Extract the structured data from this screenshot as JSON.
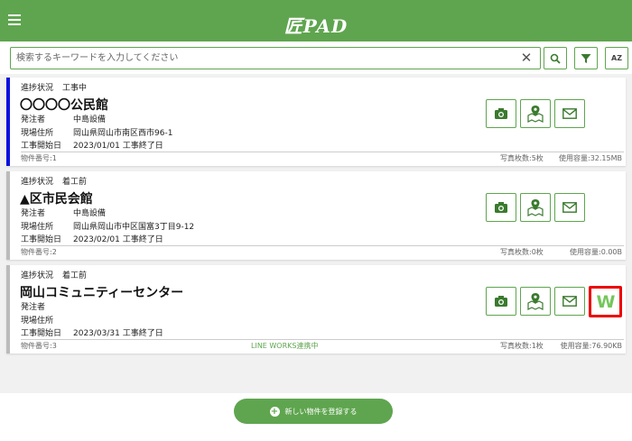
{
  "header": {
    "title": "匠PAD",
    "menu_icon": "hamburger-menu-icon"
  },
  "search": {
    "placeholder": "検索するキーワードを入力してください",
    "clear": "✕",
    "buttons": [
      "search-icon",
      "filter-icon",
      "sort-az-icon"
    ],
    "sort_label": "AZ"
  },
  "cards": [
    {
      "status_label": "進捗状況",
      "status": "工事中",
      "title": "〇〇〇〇公民館",
      "orderer_label": "発注者",
      "orderer": "中島設備",
      "address_label": "現場住所",
      "address": "岡山県岡山市南区西市96-1",
      "start_label": "工事開始日",
      "start": "2023/01/01",
      "end_label": "工事終了日",
      "number": "物件番号:1",
      "lineworks": "",
      "photos": "写真枚数:5枚",
      "usage": "使用容量:32.15MB",
      "accent": "#0b12e0"
    },
    {
      "status_label": "進捗状況",
      "status": "着工前",
      "title": "▲区市民会館",
      "orderer_label": "発注者",
      "orderer": "中島設備",
      "address_label": "現場住所",
      "address": "岡山県岡山市中区国富3丁目9-12",
      "start_label": "工事開始日",
      "start": "2023/02/01",
      "end_label": "工事終了日",
      "number": "物件番号:2",
      "lineworks": "",
      "photos": "写真枚数:0枚",
      "usage": "使用容量:0.00B",
      "accent": "#bbbbbb"
    },
    {
      "status_label": "進捗状況",
      "status": "着工前",
      "title": "岡山コミュニティーセンター",
      "orderer_label": "発注者",
      "orderer": "",
      "address_label": "現場住所",
      "address": "",
      "start_label": "工事開始日",
      "start": "2023/03/31",
      "end_label": "工事終了日",
      "number": "物件番号:3",
      "lineworks": "LINE WORKS連携中",
      "photos": "写真枚数:1枚",
      "usage": "使用容量:76.90KB",
      "accent": "#bbbbbb",
      "lineworks_button": "W"
    }
  ],
  "actions": [
    "camera-icon",
    "map-pin-icon",
    "mail-icon"
  ],
  "footer": {
    "add_label": "新しい物件を登録する"
  },
  "colors": {
    "primary": "#5fa54f",
    "active_accent": "#0b12e0",
    "highlight": "#e00000"
  }
}
